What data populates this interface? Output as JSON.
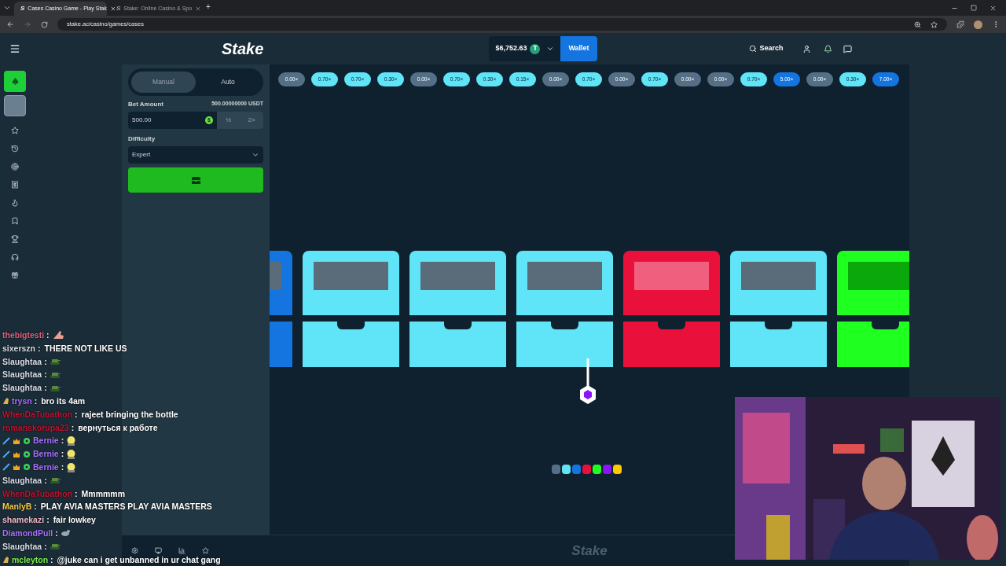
{
  "browser": {
    "tabs": [
      {
        "title": "Cases Casino Game - Play Stak",
        "favicon": "S",
        "selected": true
      },
      {
        "title": "Stake: Online Casino & Spo",
        "favicon": "S",
        "selected": false
      }
    ],
    "new_tab": "+",
    "url": "stake.ac/casino/games/cases"
  },
  "header": {
    "logo": "Stake",
    "balance": "$6,752.63",
    "currency_badge": "T",
    "wallet_button": "Wallet",
    "search": "Search"
  },
  "bet_panel": {
    "modes": [
      {
        "label": "Manual",
        "selected": true
      },
      {
        "label": "Auto",
        "selected": false
      }
    ],
    "bet_amount_label": "Bet Amount",
    "bet_amount_value": "500.00000000 USDT",
    "bet_input": "500.00",
    "coin_badge": "$",
    "half": "½",
    "double": "2×",
    "difficulty_label": "Difficulty",
    "difficulty_value": "Expert"
  },
  "history": [
    {
      "label": "0.00×",
      "color": "#557086"
    },
    {
      "label": "0.70×",
      "color": "#5fe5f7"
    },
    {
      "label": "0.70×",
      "color": "#5fe5f7"
    },
    {
      "label": "0.30×",
      "color": "#5fe5f7"
    },
    {
      "label": "0.00×",
      "color": "#557086"
    },
    {
      "label": "0.70×",
      "color": "#5fe5f7"
    },
    {
      "label": "0.30×",
      "color": "#5fe5f7"
    },
    {
      "label": "0.15×",
      "color": "#5fe5f7"
    },
    {
      "label": "0.00×",
      "color": "#557086"
    },
    {
      "label": "0.70×",
      "color": "#5fe5f7"
    },
    {
      "label": "0.00×",
      "color": "#557086"
    },
    {
      "label": "0.70×",
      "color": "#5fe5f7"
    },
    {
      "label": "0.00×",
      "color": "#557086"
    },
    {
      "label": "0.00×",
      "color": "#557086"
    },
    {
      "label": "0.70×",
      "color": "#5fe5f7"
    },
    {
      "label": "5.00×",
      "color": "#1475e1"
    },
    {
      "label": "0.00×",
      "color": "#557086"
    },
    {
      "label": "0.30×",
      "color": "#5fe5f7"
    },
    {
      "label": "7.00×",
      "color": "#1475e1"
    }
  ],
  "cases": [
    {
      "color": "#1475e1"
    },
    {
      "color": "#5fe5f7"
    },
    {
      "color": "#5fe5f7"
    },
    {
      "color": "#5fe5f7"
    },
    {
      "color": "#e9113c"
    },
    {
      "color": "#5fe5f7"
    },
    {
      "color": "#1fff20"
    }
  ],
  "legend": [
    {
      "color": "#557086"
    },
    {
      "color": "#5fe5f7"
    },
    {
      "color": "#1475e1"
    },
    {
      "color": "#e9113c"
    },
    {
      "color": "#1fff20"
    },
    {
      "color": "#8b16f5"
    },
    {
      "color": "#ffc800"
    }
  ],
  "footer_logo": "Stake",
  "chat": [
    {
      "user": "thebigtesti",
      "sep": ":",
      "color": "#e0607e",
      "kind": "hand"
    },
    {
      "user": "sixerszn",
      "sep": ":",
      "color": "#d8dce6",
      "kind": "text",
      "text": "THERE NOT LIKE US"
    },
    {
      "user": "Slaughtaa",
      "sep": ":",
      "color": "#d8dce6",
      "kind": "tank"
    },
    {
      "user": "Slaughtaa",
      "sep": ":",
      "color": "#d8dce6",
      "kind": "tank"
    },
    {
      "user": "Slaughtaa",
      "sep": ":",
      "color": "#d8dce6",
      "kind": "tank"
    },
    {
      "user": "trysn",
      "sep": ":",
      "color": "#a970ff",
      "badges": [
        {
          "kind": "hand"
        }
      ],
      "kind": "text",
      "text": "bro its 4am"
    },
    {
      "user": "WhenDaTubathon",
      "sep": ":",
      "color": "#c4122f",
      "kind": "text",
      "text": "rajeet bringing the bottle"
    },
    {
      "user": "romanskorupa23",
      "sep": ":",
      "color": "#c4122f",
      "kind": "text",
      "text": "вернуться к работе"
    },
    {
      "user": "Bernie",
      "sep": ":",
      "color": "#a970ff",
      "badges": [
        {
          "kind": "sword"
        },
        {
          "kind": "crown"
        },
        {
          "kind": "gear"
        }
      ],
      "kind": "face"
    },
    {
      "user": "Bernie",
      "sep": ":",
      "color": "#a970ff",
      "badges": [
        {
          "kind": "sword"
        },
        {
          "kind": "crown"
        },
        {
          "kind": "gear"
        }
      ],
      "kind": "face"
    },
    {
      "user": "Bernie",
      "sep": ":",
      "color": "#a970ff",
      "badges": [
        {
          "kind": "sword"
        },
        {
          "kind": "crown"
        },
        {
          "kind": "gear"
        }
      ],
      "kind": "face"
    },
    {
      "user": "Slaughtaa",
      "sep": ":",
      "color": "#d8dce6",
      "kind": "tank"
    },
    {
      "user": "WhenDaTubathon",
      "sep": ":",
      "color": "#c4122f",
      "kind": "text",
      "text": "Mmmmmm"
    },
    {
      "user": "ManlyB",
      "sep": ":",
      "color": "#f2c94c",
      "kind": "text",
      "text": "PLAY AVIA MASTERS PLAY AVIA MASTERS"
    },
    {
      "user": "shamekazi",
      "sep": ":",
      "color": "#f0b8c8",
      "kind": "text",
      "text": "fair lowkey"
    },
    {
      "user": "DiamondPull",
      "sep": ":",
      "color": "#a970ff",
      "kind": "animal"
    },
    {
      "user": "Slaughtaa",
      "sep": ":",
      "color": "#d8dce6",
      "kind": "tank"
    },
    {
      "user": "mcleyton",
      "sep": ":",
      "color": "#7cf04a",
      "badges": [
        {
          "kind": "hand"
        }
      ],
      "kind": "text",
      "text": "@juke can i get unbanned in ur chat gang"
    }
  ]
}
